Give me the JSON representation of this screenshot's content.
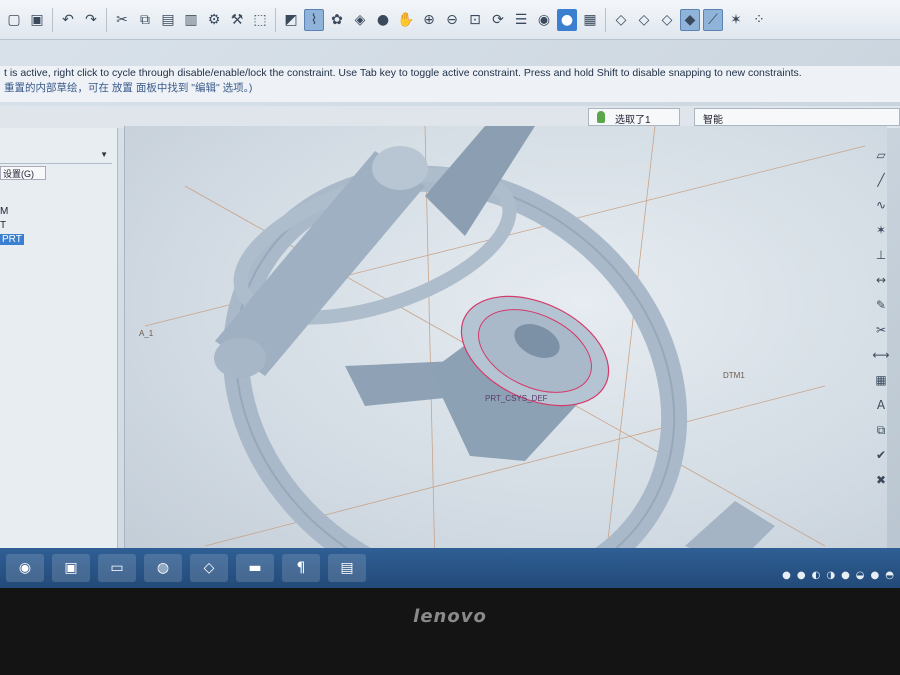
{
  "toolbar": {
    "icons": [
      "open-icon",
      "save-icon",
      "undo-icon",
      "redo-icon",
      "cut-icon",
      "copy-icon",
      "paste-icon",
      "paste-special-icon",
      "regenerate-icon",
      "repaint-icon",
      "select-box-icon",
      "orient-icon",
      "snap-icon",
      "display-style-icon",
      "appearance-icon",
      "sphere-icon",
      "pan-icon",
      "zoom-in-icon",
      "zoom-out-icon",
      "refit-icon",
      "spin-center-icon",
      "layers-icon",
      "view-icon",
      "manager-icon",
      "plane-display-icon",
      "axis-display-icon",
      "point-display-icon",
      "csys-display-icon",
      "annotation-display-icon"
    ]
  },
  "message": {
    "line1": "t is active, right click to cycle through disable/enable/lock the constraint. Use Tab key to toggle active constraint. Press and hold Shift to disable snapping to new constraints.",
    "line2": "重置的内部草绘，可在 放置 面板中找到 \"编辑\" 选项。)"
  },
  "status": {
    "selection": "选取了1",
    "filter": "智能"
  },
  "leftpanel": {
    "filter_label": "设置(G)",
    "items": [
      "M",
      "T",
      "PRT"
    ]
  },
  "viewport": {
    "labels": [
      "PRT_CSYS_DEF",
      "DTM1",
      "A_1"
    ]
  },
  "taskbar": {
    "apps": [
      "start",
      "explorer",
      "folder",
      "media",
      "creo",
      "terminal",
      "pdf",
      "notepad"
    ]
  },
  "bezel": {
    "brand": "lenovo"
  }
}
